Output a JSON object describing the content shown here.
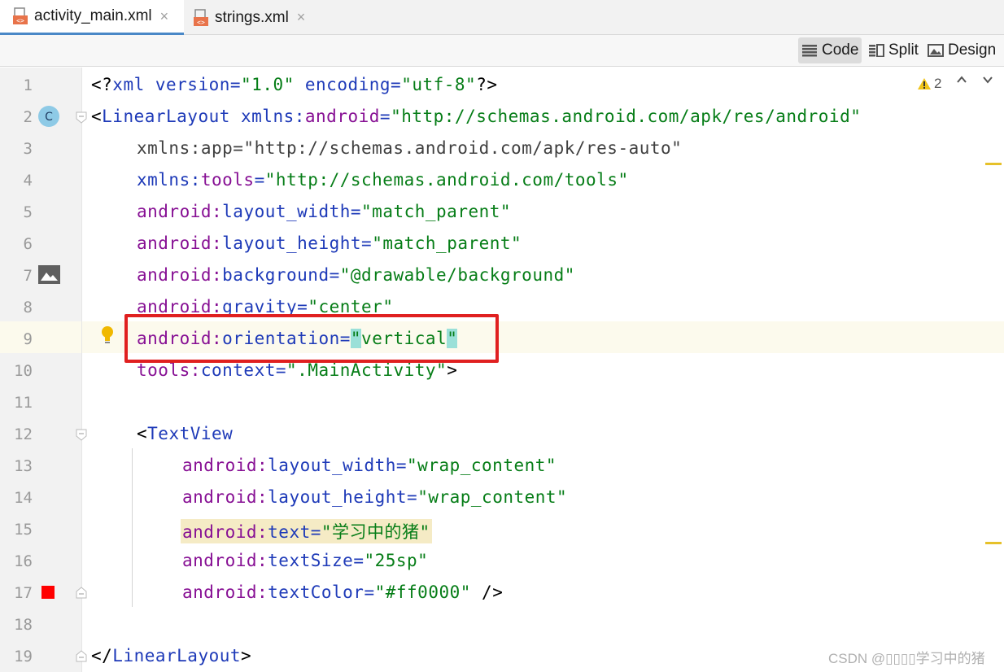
{
  "tabs": [
    {
      "label": "activity_main.xml",
      "active": true
    },
    {
      "label": "strings.xml",
      "active": false
    }
  ],
  "tab_close_glyph": "×",
  "view_modes": {
    "code": "Code",
    "split": "Split",
    "design": "Design",
    "selected": "code"
  },
  "inspection": {
    "warning_count": "2"
  },
  "line_numbers": [
    "1",
    "2",
    "3",
    "4",
    "5",
    "6",
    "7",
    "8",
    "9",
    "10",
    "11",
    "12",
    "13",
    "14",
    "15",
    "16",
    "17",
    "18",
    "19"
  ],
  "code": {
    "l1": {
      "a": "<?",
      "b": "xml",
      "c": " version=",
      "d": "\"1.0\"",
      "e": " encoding=",
      "f": "\"utf-8\"",
      "g": "?>"
    },
    "l2": {
      "a": "<",
      "b": "LinearLayout",
      "c": " xmlns:",
      "d": "android",
      "e": "=",
      "f": "\"http://schemas.android.com/apk/res/android\""
    },
    "l3": {
      "a": "xmlns:app=\"http://schemas.android.com/apk/res-auto\""
    },
    "l4": {
      "a": "xmlns:",
      "b": "tools",
      "c": "=",
      "d": "\"http://schemas.android.com/tools\""
    },
    "l5": {
      "a": "android:",
      "b": "layout_width",
      "c": "=",
      "d": "\"match_parent\""
    },
    "l6": {
      "a": "android:",
      "b": "layout_height",
      "c": "=",
      "d": "\"match_parent\""
    },
    "l7": {
      "a": "android:",
      "b": "background",
      "c": "=",
      "d": "\"@drawable/background\""
    },
    "l8": {
      "a": "android:",
      "b": "gravity",
      "c": "=",
      "d": "\"center\""
    },
    "l9": {
      "a": "android:",
      "b": "orientation",
      "c": "=",
      "q1": "\"",
      "d": "vertical",
      "q2": "\""
    },
    "l10": {
      "a": "tools:",
      "b": "context",
      "c": "=",
      "d": "\".MainActivity\"",
      "e": ">"
    },
    "l12": {
      "a": "<",
      "b": "TextView"
    },
    "l13": {
      "a": "android:",
      "b": "layout_width",
      "c": "=",
      "d": "\"wrap_content\""
    },
    "l14": {
      "a": "android:",
      "b": "layout_height",
      "c": "=",
      "d": "\"wrap_content\""
    },
    "l15": {
      "a": "android:",
      "b": "text",
      "c": "=",
      "d": "\"学习中的猪\""
    },
    "l16": {
      "a": "android:",
      "b": "textSize",
      "c": "=",
      "d": "\"25sp\""
    },
    "l17": {
      "a": "android:",
      "b": "textColor",
      "c": "=",
      "d": "\"#ff0000\"",
      "e": " />"
    },
    "l19": {
      "a": "</",
      "b": "LinearLayout",
      "c": ">"
    }
  },
  "gutter_icons": {
    "class_badge_letter": "C",
    "color_swatch": "#ff0000"
  },
  "watermark": "CSDN @▯▯▯▯学习中的猪",
  "colors": {
    "accent": "#4a88c7",
    "highlight_box": "#e02020",
    "warning": "#e6c12a"
  }
}
